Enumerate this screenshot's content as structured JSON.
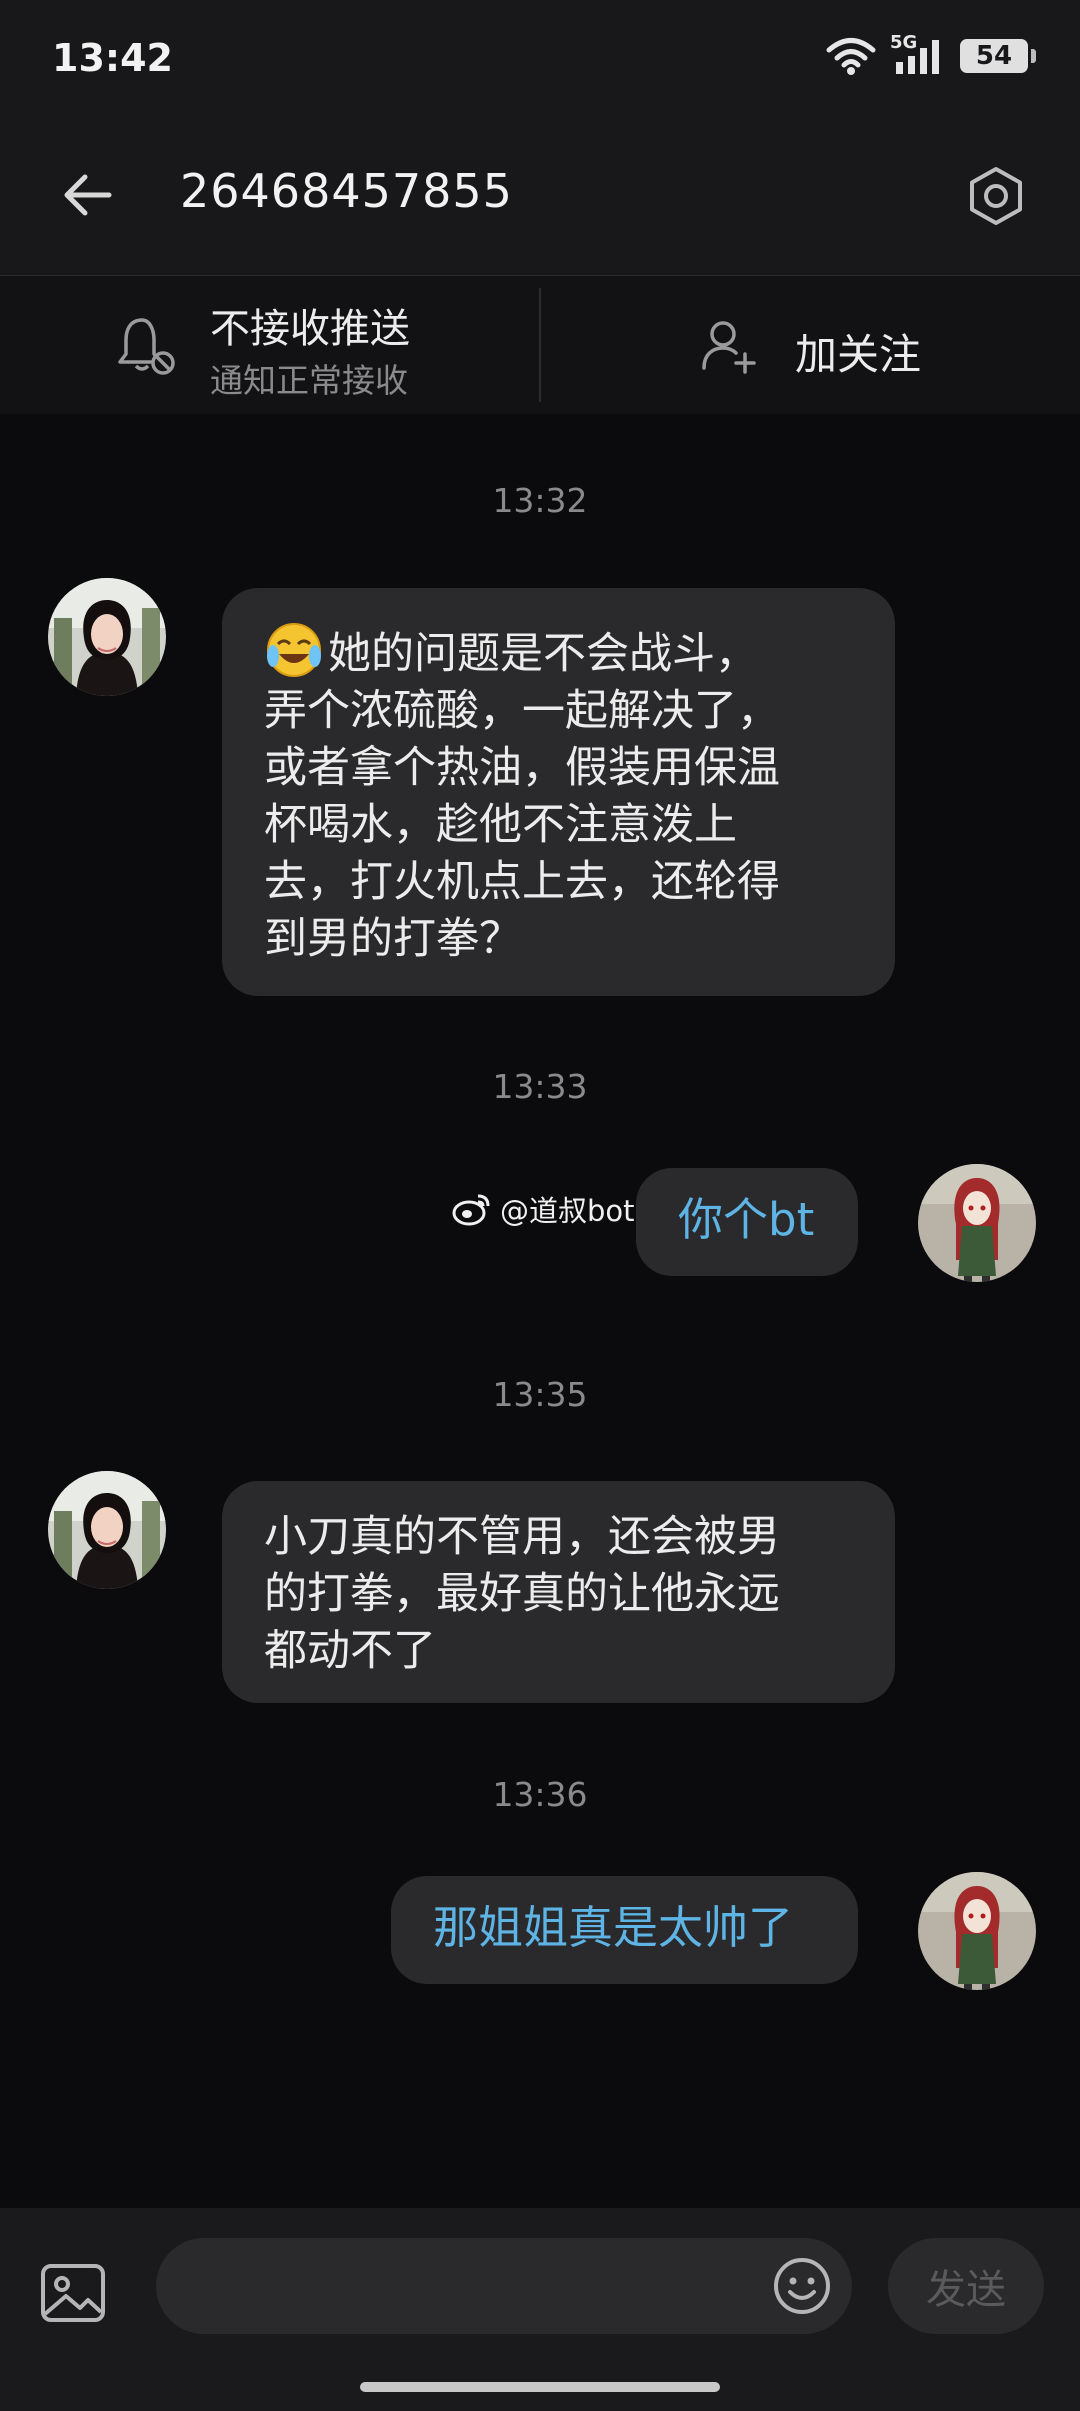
{
  "status_bar": {
    "time": "13:42",
    "network": "5G",
    "battery": "54"
  },
  "header": {
    "title": "26468457855"
  },
  "actions": {
    "push_title": "不接收推送",
    "push_subtitle": "通知正常接收",
    "follow_label": "加关注"
  },
  "messages": [
    {
      "time": "13:32",
      "side": "incoming",
      "emoji": "crying-laughing-emoji",
      "text_lines": [
        "她的问题是不会战斗，",
        "弄个浓硫酸，一起解决了，",
        "或者拿个热油，假装用保温",
        "杯喝水，趁他不注意泼上",
        "去，打火机点上去，还轮得",
        "到男的打拳？"
      ]
    },
    {
      "time": "13:33",
      "side": "outgoing",
      "text": "你个bt"
    },
    {
      "time": "13:35",
      "side": "incoming",
      "text_lines": [
        "小刀真的不管用，还会被男",
        "的打拳，最好真的让他永远",
        "都动不了"
      ]
    },
    {
      "time": "13:36",
      "side": "outgoing",
      "text": "那姐姐真是太帅了"
    }
  ],
  "watermark": {
    "text": "@道叔bot"
  },
  "composer": {
    "placeholder": "",
    "send_label": "发送"
  },
  "colors": {
    "background": "#0b0b0d",
    "bubble": "#2a2a2c",
    "outgoing_text": "#5fb4e6"
  }
}
